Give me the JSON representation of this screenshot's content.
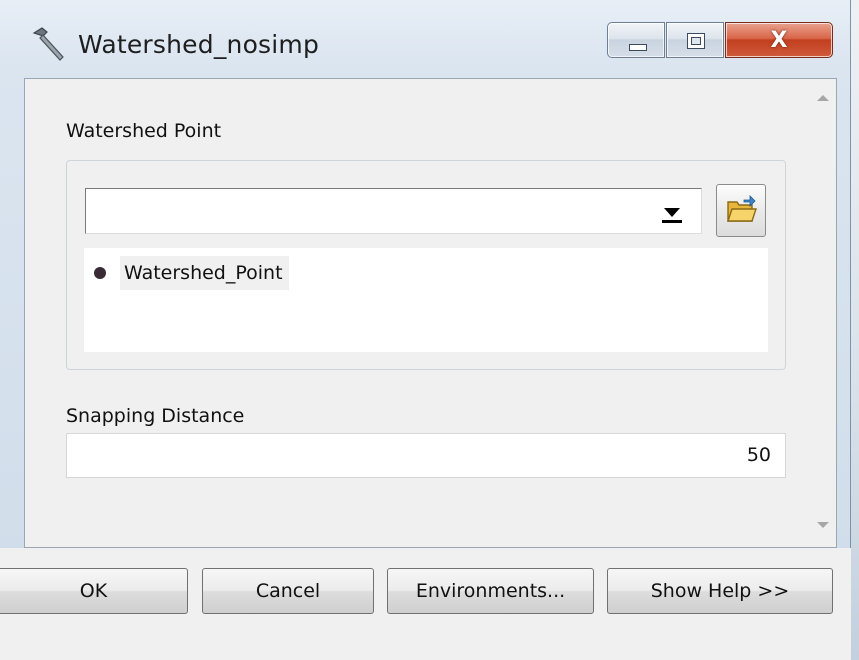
{
  "window": {
    "title": "Watershed_nosimp",
    "close_glyph": "X",
    "icon": "hammer-icon"
  },
  "form": {
    "watershed_point": {
      "label": "Watershed Point",
      "combo_value": "",
      "items": [
        {
          "name": "Watershed_Point",
          "icon": "point-layer-icon"
        }
      ]
    },
    "snapping_distance": {
      "label": "Snapping Distance",
      "value": "50"
    }
  },
  "buttons": {
    "ok": "OK",
    "cancel": "Cancel",
    "environments": "Environments...",
    "show_help": "Show Help >>"
  },
  "colors": {
    "close_button": "#c23f1f",
    "window_frame": "#d4e0ec",
    "selected_item_bg": "#f0f0f0"
  }
}
